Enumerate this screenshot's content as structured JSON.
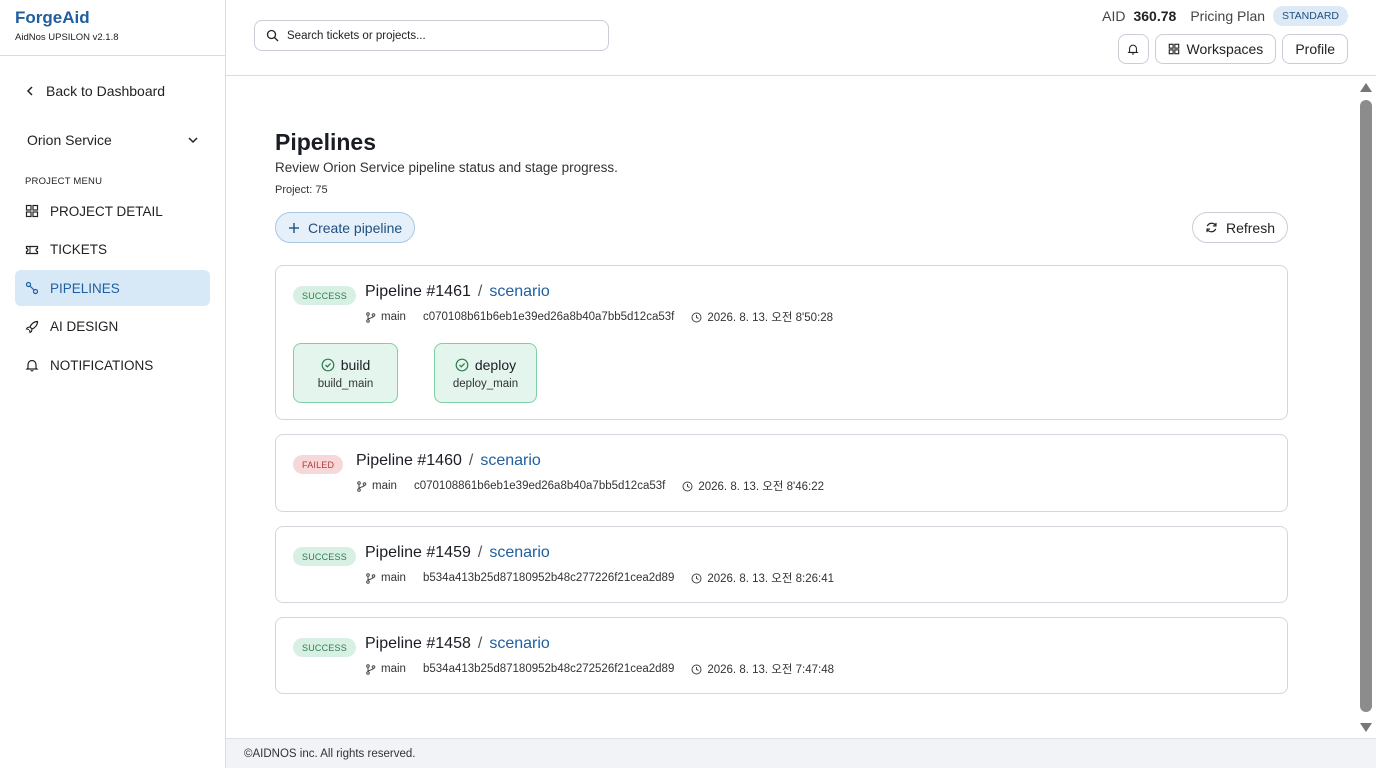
{
  "brand": {
    "name": "ForgeAid",
    "version": "AidNos UPSILON v2.1.8"
  },
  "sidebar": {
    "back_label": "Back to Dashboard",
    "project_name": "Orion Service",
    "menu_heading": "PROJECT MENU",
    "items": [
      {
        "label": "PROJECT DETAIL",
        "icon": "grid-icon",
        "active": false
      },
      {
        "label": "TICKETS",
        "icon": "ticket-icon",
        "active": false
      },
      {
        "label": "PIPELINES",
        "icon": "pipeline-icon",
        "active": true
      },
      {
        "label": "AI DESIGN",
        "icon": "rocket-icon",
        "active": false
      },
      {
        "label": "NOTIFICATIONS",
        "icon": "bell-icon",
        "active": false
      }
    ]
  },
  "header": {
    "search_placeholder": "Search tickets or projects...",
    "aid_label": "AID",
    "aid_value": "360.78",
    "plan_label": "Pricing Plan",
    "plan_value": "STANDARD",
    "workspaces_label": "Workspaces",
    "profile_label": "Profile"
  },
  "main": {
    "title": "Pipelines",
    "subtitle": "Review Orion Service pipeline status and stage progress.",
    "project_line": "Project: 75",
    "create_label": "Create pipeline",
    "refresh_label": "Refresh"
  },
  "pipelines": [
    {
      "status": "SUCCESS",
      "title": "Pipeline #1461",
      "slash": "/",
      "source": "scenario",
      "branch": "main",
      "sha": "c070108b61b6eb1e39ed26a8b40a7bb5d12ca53f",
      "time": "2026. 8. 13. 오전 8'50:28",
      "stages": [
        {
          "name": "build",
          "job": "build_main"
        },
        {
          "name": "deploy",
          "job": "deploy_main"
        }
      ]
    },
    {
      "status": "FAILED",
      "title": "Pipeline #1460",
      "slash": "/",
      "source": "scenario",
      "branch": "main",
      "sha": "c070108861b6eb1e39ed26a8b40a7bb5d12ca53f",
      "time": "2026. 8. 13. 오전 8'46:22",
      "stages": []
    },
    {
      "status": "SUCCESS",
      "title": "Pipeline #1459",
      "slash": "/",
      "source": "scenario",
      "branch": "main",
      "sha": "b534a413b25d87180952b48c277226f21cea2d89",
      "time": "2026. 8. 13. 오전 8:26:41",
      "stages": []
    },
    {
      "status": "SUCCESS",
      "title": "Pipeline #1458",
      "slash": "/",
      "source": "scenario",
      "branch": "main",
      "sha": "b534a413b25d87180952b48c272526f21cea2d89",
      "time": "2026. 8. 13. 오전 7:47:48",
      "stages": []
    }
  ],
  "footer": {
    "text": "©AIDNOS inc. All rights reserved."
  },
  "colors": {
    "brand": "#1f5f9e",
    "success": "#2f7d4f",
    "failed": "#b03a3a",
    "active_bg": "#d7e8f7"
  }
}
